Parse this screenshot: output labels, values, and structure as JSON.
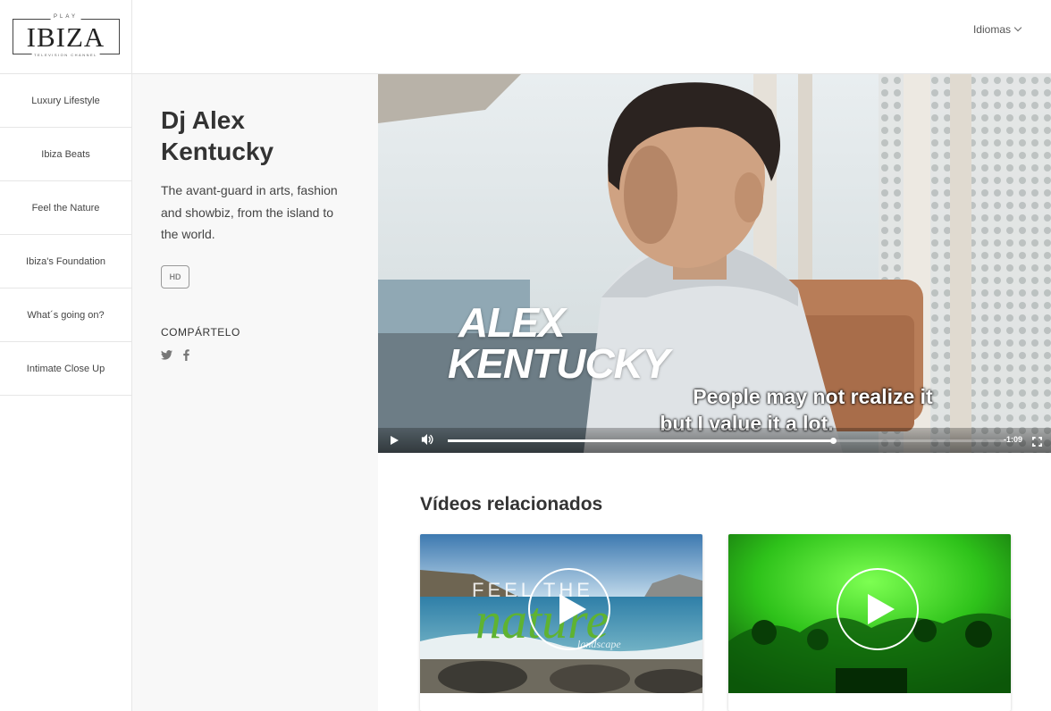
{
  "brand": {
    "top": "PLAY",
    "name": "IBIZA",
    "tagline": "TELEVISION CHANNEL"
  },
  "header": {
    "language_label": "Idiomas"
  },
  "sidebar": {
    "items": [
      {
        "label": "Luxury Lifestyle"
      },
      {
        "label": "Ibiza Beats"
      },
      {
        "label": "Feel the Nature"
      },
      {
        "label": "Ibiza's Foundation"
      },
      {
        "label": "What´s going on?"
      },
      {
        "label": "Intimate Close Up"
      }
    ]
  },
  "video_info": {
    "title_line1": "Dj Alex",
    "title_line2": "Kentucky",
    "description": "The avant-guard in arts, fashion and showbiz, from the island to the world.",
    "quality_badge": "HD",
    "share_label": "COMPÁRTELO",
    "social": [
      "twitter-icon",
      "facebook-icon"
    ]
  },
  "player": {
    "overlay_name_line1": "ALEX",
    "overlay_name_line2": "KENTUCKY",
    "subtitle_line1": "People may not realize it",
    "subtitle_line2": "but I value it a lot.",
    "time_remaining": "-1:09",
    "progress_fraction": 0.69,
    "controls": [
      "play-icon",
      "volume-icon",
      "fullscreen-icon"
    ]
  },
  "related": {
    "title": "Vídeos relacionados",
    "cards": [
      {
        "thumb_text_line1": "FEEL THE",
        "thumb_text_line2": "nature",
        "thumb_text_line3": "landscape"
      },
      {
        "thumb_text_line1": ""
      }
    ]
  },
  "colors": {
    "accent_green": "#5fb331",
    "sidebar_border": "#e6e6e6",
    "panel_bg": "#f8f8f8"
  }
}
